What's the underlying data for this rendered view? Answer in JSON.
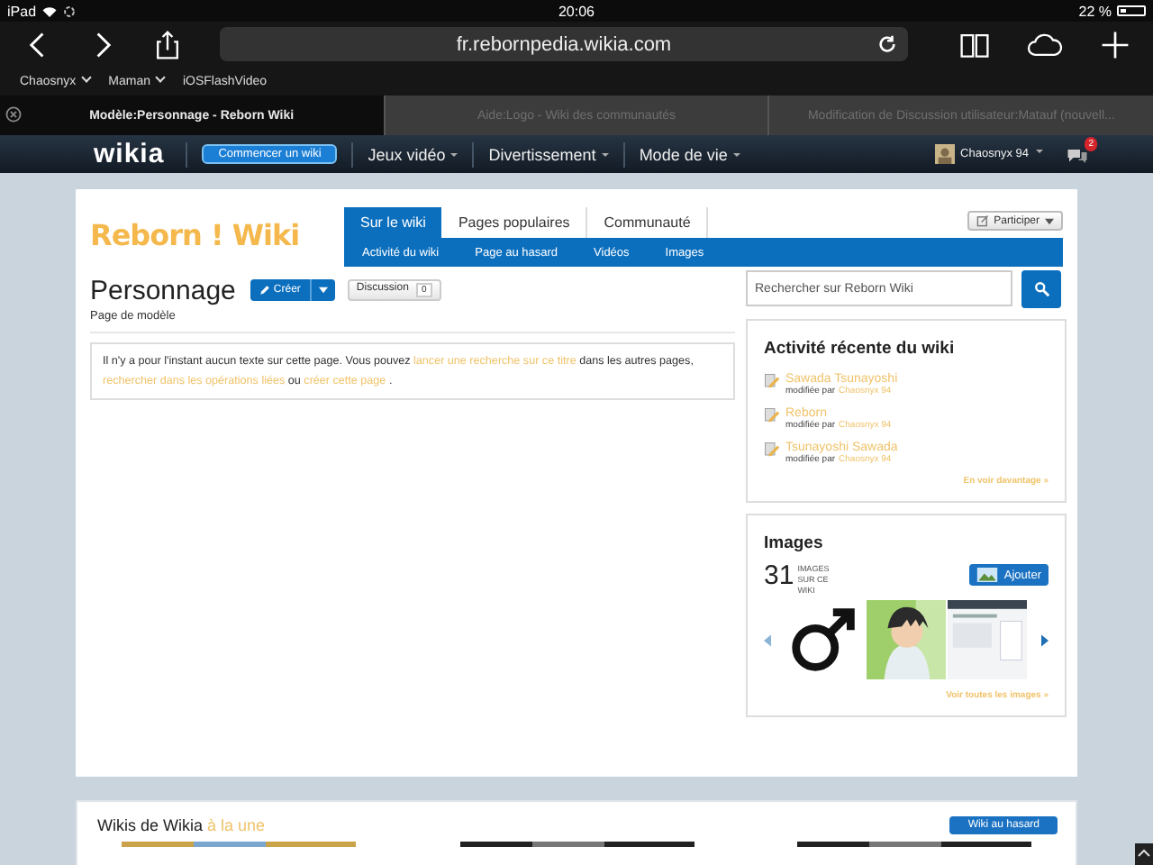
{
  "status_bar": {
    "device": "iPad",
    "time": "20:06",
    "battery": "22 %"
  },
  "browser": {
    "url": "fr.rebornpedia.wikia.com",
    "bookmarks": [
      {
        "label": "Chaosnyx",
        "kind": "folder"
      },
      {
        "label": "Maman",
        "kind": "folder"
      },
      {
        "label": "iOSFlashVideo",
        "kind": "link"
      }
    ],
    "tabs": [
      {
        "title": "Modèle:Personnage - Reborn Wiki",
        "selected": true
      },
      {
        "title": "Aide:Logo - Wiki des communautés",
        "selected": false
      },
      {
        "title": "Modification de Discussion utilisateur:Matauf (nouvell...",
        "selected": false
      }
    ]
  },
  "wikia_bar": {
    "logo": "wikia",
    "start_button": "Commencer un wiki",
    "menus": [
      "Jeux vidéo",
      "Divertissement",
      "Mode de vie"
    ],
    "user": "Chaosnyx 94",
    "notifications": "2"
  },
  "wiki": {
    "name": "Reborn ! Wiki",
    "participate": "Participer",
    "tabs": [
      {
        "label": "Sur le wiki",
        "selected": true
      },
      {
        "label": "Pages populaires",
        "selected": false
      },
      {
        "label": "Communauté",
        "selected": false
      }
    ],
    "subnav": [
      "Activité du wiki",
      "Page au hasard",
      "Vidéos",
      "Images"
    ]
  },
  "page": {
    "title": "Personnage",
    "create": "Créer",
    "discussion": "Discussion",
    "discussion_count": "0",
    "subtitle": "Page de modèle",
    "notice": [
      {
        "kind": "text",
        "text": "Il n'y a pour l'instant aucun texte sur cette page. Vous pouvez"
      },
      {
        "kind": "link",
        "text": "lancer une recherche sur ce titre"
      },
      {
        "kind": "text",
        "text": "dans les autres pages,"
      },
      {
        "kind": "link",
        "text": "rechercher dans les opérations liées"
      },
      {
        "kind": "text",
        "text": "ou"
      },
      {
        "kind": "link",
        "text": "créer cette page"
      },
      {
        "kind": "text",
        "text": "."
      }
    ]
  },
  "rail": {
    "search": {
      "placeholder": "Rechercher sur Reborn Wiki"
    },
    "activity": {
      "title": "Activité récente du wiki",
      "items": [
        {
          "page": "Sawada Tsunayoshi",
          "by": "modifiée par",
          "user": "Chaosnyx 94"
        },
        {
          "page": "Reborn",
          "by": "modifiée par",
          "user": "Chaosnyx 94"
        },
        {
          "page": "Tsunayoshi Sawada",
          "by": "modifiée par",
          "user": "Chaosnyx 94"
        }
      ],
      "more": "En voir davantage »"
    },
    "images": {
      "title": "Images",
      "count": "31",
      "count_label": "IMAGES SUR CE WIKI",
      "add": "Ajouter",
      "see_all": "Voir toutes les images »"
    }
  },
  "featured": {
    "title": "Wikis de Wikia",
    "highlight": "à la une",
    "button": "Wiki au hasard"
  }
}
